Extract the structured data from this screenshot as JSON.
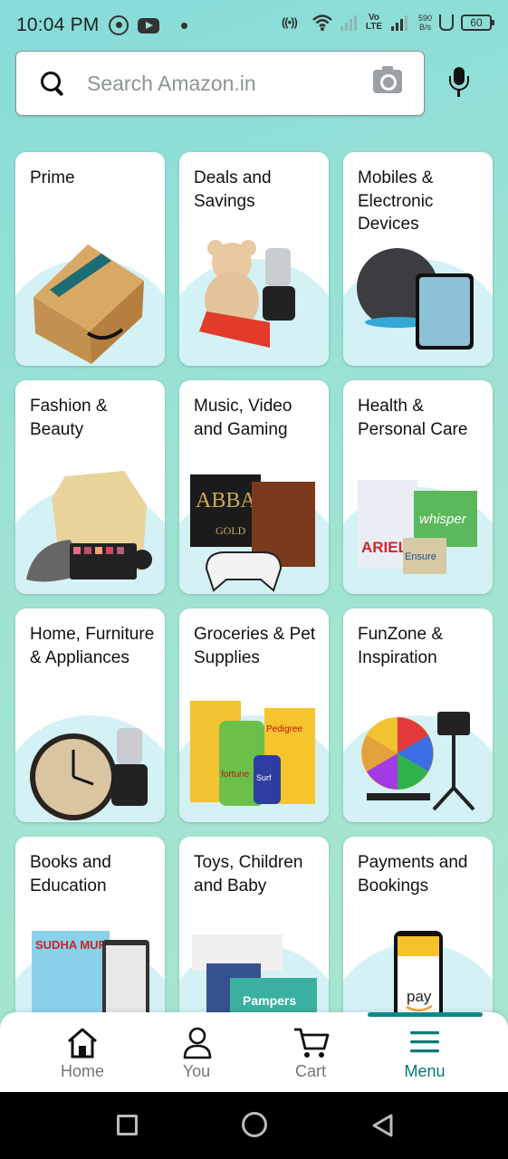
{
  "status_bar": {
    "time": "10:04 PM",
    "network_type": "Vo LTE",
    "speed_value": "590",
    "speed_unit": "B/s",
    "battery": "60"
  },
  "search": {
    "placeholder": "Search Amazon.in"
  },
  "categories": [
    {
      "label": "Prime"
    },
    {
      "label": "Deals and Savings"
    },
    {
      "label": "Mobiles & Electronic Devices"
    },
    {
      "label": "Fashion & Beauty"
    },
    {
      "label": "Music, Video and Gaming"
    },
    {
      "label": "Health & Personal Care"
    },
    {
      "label": "Home, Furniture & Appliances"
    },
    {
      "label": "Groceries & Pet Supplies"
    },
    {
      "label": "FunZone & Inspiration"
    },
    {
      "label": "Books and Education"
    },
    {
      "label": "Toys, Children and Baby"
    },
    {
      "label": "Payments and Bookings"
    }
  ],
  "product_art_text": {
    "abba_title": "ABBA",
    "abba_sub": "GOLD",
    "ariel": "ARIEL",
    "whisper": "whisper",
    "ensure": "Ensure",
    "pedigree": "Pedigree",
    "fortune": "fortune",
    "surf": "Surf",
    "book_author": "SUDHA MURTY",
    "pampers": "Pampers",
    "pay": "pay"
  },
  "bottom_nav": {
    "home": "Home",
    "you": "You",
    "cart": "Cart",
    "menu": "Menu",
    "active": "menu"
  },
  "colors": {
    "accent": "#007a78",
    "card_arc": "#d4f1f5",
    "background_start": "#86dcd8",
    "background_end": "#a9e6cf"
  }
}
